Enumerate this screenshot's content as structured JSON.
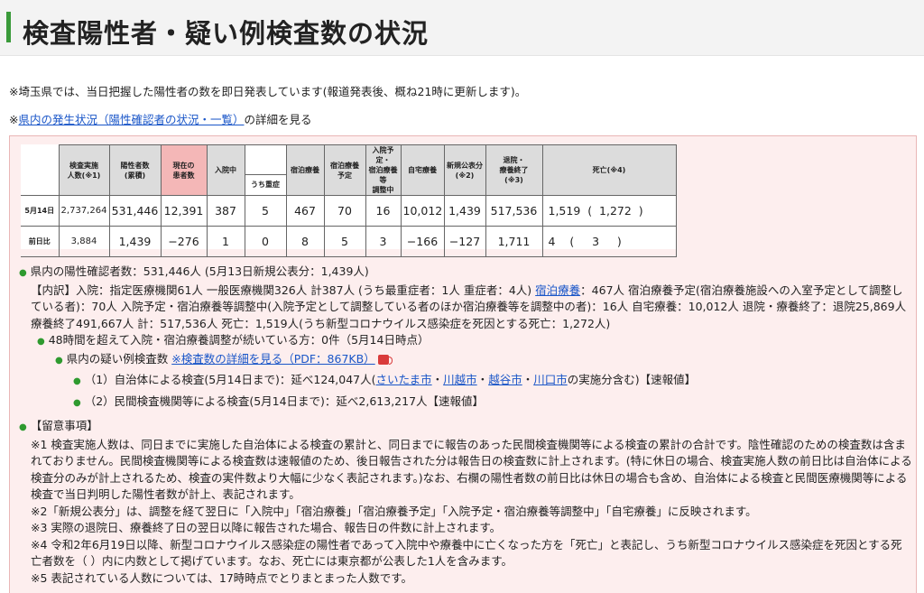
{
  "page": {
    "title": "検査陽性者・疑い例検査数の状況",
    "intro": "※埼玉県では、当日把握した陽性者の数を即日発表しています(報道発表後、概ね21時に更新します)。",
    "detail_prefix": "※",
    "detail_link": "県内の発生状況（陽性確認者の状況・一覧）",
    "detail_suffix": "の詳細を見る"
  },
  "table": {
    "headers": {
      "tests": "検査実施\n人数(※1)",
      "positives": "陽性者数\n(累積)",
      "current": "現在の\n患者数",
      "hospitalized": "入院中",
      "severe": "うち重症",
      "lodging": "宿泊療養",
      "lodging_plan": "宿泊療養\n予定",
      "adjusting": "入院予定・\n宿泊療養等\n調整中",
      "home": "自宅療養",
      "new_public": "新規公表分\n(※2)",
      "discharged": "退院・\n療養終了\n(※3)",
      "deaths": "死亡(※4)"
    },
    "rows": [
      {
        "label": "5月14日",
        "tests": "2,737,264",
        "positives": "531,446",
        "current": "12,391",
        "hospitalized": "387",
        "severe": "5",
        "lodging": "467",
        "lodging_plan": "70",
        "adjusting": "16",
        "home": "10,012",
        "new_public": "1,439",
        "discharged": "517,536",
        "deaths": "1,519  (  1,272  )"
      },
      {
        "label": "前日比",
        "tests": "3,884",
        "positives": "1,439",
        "current": "−276",
        "hospitalized": "1",
        "severe": "0",
        "lodging": "8",
        "lodging_plan": "5",
        "adjusting": "3",
        "home": "−166",
        "new_public": "−127",
        "discharged": "1,711",
        "deaths": "4    (     3     )"
      }
    ]
  },
  "summary": {
    "heading": "県内の陽性確認者数：531,446人 (5月13日新規公表分：1,439人)",
    "breakdown_a": "【内訳】入院：指定医療機関61人 一般医療機関326人 計387人 (うち最重症者：1人 重症者：4人) ",
    "breakdown_link": "宿泊療養",
    "breakdown_b": "：467人 宿泊療養予定(宿泊療養施設への入室予定として調整している者)：70人 入院予定・宿泊療養等調整中(入院予定として調整している者のほか宿泊療養等を調整中の者)：16人 自宅療養：10,012人 退院・療養終了：退院25,869人 療養終了491,667人 計：517,536人 死亡：1,519人(うち新型コロナウイルス感染症を死因とする死亡：1,272人)",
    "over48": "48時間を超えて入院・宿泊療養調整が続いている方：0件（5月14日時点）",
    "suspect_label": "県内の疑い例検査数 ",
    "suspect_link": "※検査数の詳細を見る（PDF：867KB）",
    "local_a": "（1）自治体による検査(5月14日まで)：延べ124,047人(",
    "local_cities": [
      "さいたま市",
      "川越市",
      "越谷市",
      "川口市"
    ],
    "local_b": "の実施分含む)【速報値】",
    "private": "（2）民間検査機関等による検査(5月14日まで)：延べ2,613,217人【速報値】"
  },
  "notes": {
    "heading": "【留意事項】",
    "n1": "※1 検査実施人数は、同日までに実施した自治体による検査の累計と、同日までに報告のあった民間検査機関等による検査の累計の合計です。陰性確認のための検査数は含まれておりません。民間検査機関等による検査数は速報値のため、後日報告された分は報告日の検査数に計上されます。(特に休日の場合、検査実施人数の前日比は自治体による検査分のみが計上されるため、検査の実件数より大幅に少なく表記されます。)なお、右欄の陽性者数の前日比は休日の場合も含め、自治体による検査と民間医療機関等による検査で当日判明した陽性者数が計上、表記されます。",
    "n2": "※2「新規公表分」は、調整を経て翌日に「入院中」「宿泊療養」「宿泊療養予定」「入院予定・宿泊療養等調整中」「自宅療養」に反映されます。",
    "n3": "※3 実際の退院日、療養終了日の翌日以降に報告された場合、報告日の件数に計上されます。",
    "n4": "※4 令和2年6月19日以降、新型コロナウイルス感染症の陽性者であって入院中や療養中に亡くなった方を「死亡」と表記し、うち新型コロナウイルス感染症を死因とする死亡者数を（ ）内に内数として掲げています。なお、死亡には東京都が公表した1人を含みます。",
    "n5": "※5 表記されている人数については、17時時点でとりまとまった人数です。"
  },
  "colors": {
    "accent": "#3a9a3a",
    "link": "#1a56c8",
    "box_bg": "#fdeeee",
    "header_red": "#f4b7b7"
  }
}
